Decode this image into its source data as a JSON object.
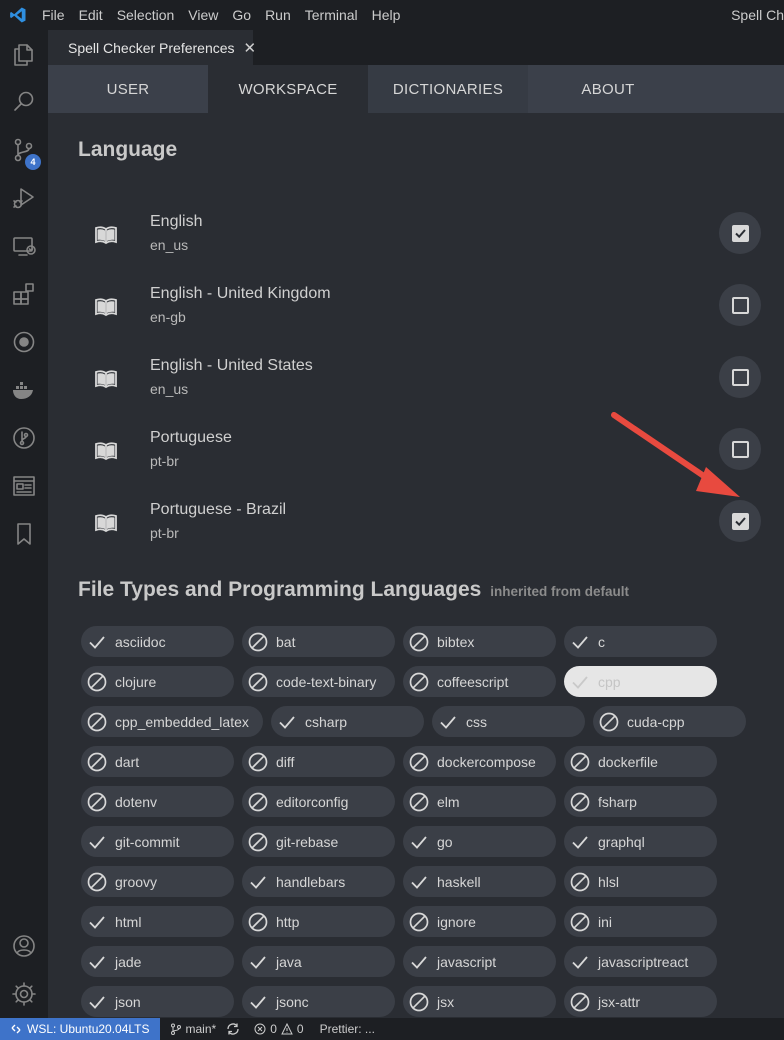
{
  "titlebar": {
    "menu": [
      "File",
      "Edit",
      "Selection",
      "View",
      "Go",
      "Run",
      "Terminal",
      "Help"
    ],
    "window_title": "Spell Ch"
  },
  "activity_bar": {
    "icons": [
      "explorer-icon",
      "search-icon",
      "source-control-icon",
      "run-debug-icon",
      "remote-explorer-icon",
      "extensions-icon",
      "gitlens-icon",
      "docker-icon",
      "git-graph-icon",
      "preview-icon",
      "bookmarks-icon",
      "account-icon",
      "settings-gear-icon"
    ],
    "source_control_badge": "4"
  },
  "editor_tab": {
    "label": "Spell Checker Preferences",
    "close": "✕"
  },
  "nav_tabs": [
    {
      "label": "USER"
    },
    {
      "label": "WORKSPACE"
    },
    {
      "label": "DICTIONARIES"
    },
    {
      "label": "ABOUT"
    }
  ],
  "language_section": {
    "title": "Language",
    "items": [
      {
        "name": "English",
        "code": "en_us",
        "checked": true
      },
      {
        "name": "English - United Kingdom",
        "code": "en-gb",
        "checked": false
      },
      {
        "name": "English - United States",
        "code": "en_us",
        "checked": false
      },
      {
        "name": "Portuguese",
        "code": "pt-br",
        "checked": false
      },
      {
        "name": "Portuguese - Brazil",
        "code": "pt-br",
        "checked": true
      }
    ]
  },
  "filetypes_section": {
    "title": "File Types and Programming Languages",
    "subtitle": "inherited from default",
    "rows": [
      [
        {
          "label": "asciidoc",
          "state": "enabled"
        },
        {
          "label": "bat",
          "state": "disabled"
        },
        {
          "label": "bibtex",
          "state": "disabled"
        },
        {
          "label": "c",
          "state": "enabled"
        }
      ],
      [
        {
          "label": "clojure",
          "state": "disabled"
        },
        {
          "label": "code-text-binary",
          "state": "disabled"
        },
        {
          "label": "coffeescript",
          "state": "disabled"
        },
        {
          "label": "cpp",
          "state": "hover"
        }
      ],
      [
        {
          "label": "cpp_embedded_latex",
          "state": "disabled"
        },
        {
          "label": "csharp",
          "state": "enabled"
        },
        {
          "label": "css",
          "state": "enabled"
        },
        {
          "label": "cuda-cpp",
          "state": "disabled"
        }
      ],
      [
        {
          "label": "dart",
          "state": "disabled"
        },
        {
          "label": "diff",
          "state": "disabled"
        },
        {
          "label": "dockercompose",
          "state": "disabled"
        },
        {
          "label": "dockerfile",
          "state": "disabled"
        }
      ],
      [
        {
          "label": "dotenv",
          "state": "disabled"
        },
        {
          "label": "editorconfig",
          "state": "disabled"
        },
        {
          "label": "elm",
          "state": "disabled"
        },
        {
          "label": "fsharp",
          "state": "disabled"
        }
      ],
      [
        {
          "label": "git-commit",
          "state": "enabled"
        },
        {
          "label": "git-rebase",
          "state": "disabled"
        },
        {
          "label": "go",
          "state": "enabled"
        },
        {
          "label": "graphql",
          "state": "enabled"
        }
      ],
      [
        {
          "label": "groovy",
          "state": "disabled"
        },
        {
          "label": "handlebars",
          "state": "enabled"
        },
        {
          "label": "haskell",
          "state": "enabled"
        },
        {
          "label": "hlsl",
          "state": "disabled"
        }
      ],
      [
        {
          "label": "html",
          "state": "enabled"
        },
        {
          "label": "http",
          "state": "disabled"
        },
        {
          "label": "ignore",
          "state": "disabled"
        },
        {
          "label": "ini",
          "state": "disabled"
        }
      ],
      [
        {
          "label": "jade",
          "state": "enabled"
        },
        {
          "label": "java",
          "state": "enabled"
        },
        {
          "label": "javascript",
          "state": "enabled"
        },
        {
          "label": "javascriptreact",
          "state": "enabled"
        }
      ],
      [
        {
          "label": "json",
          "state": "enabled"
        },
        {
          "label": "jsonc",
          "state": "enabled"
        },
        {
          "label": "jsx",
          "state": "disabled"
        },
        {
          "label": "jsx-attr",
          "state": "disabled"
        }
      ]
    ]
  },
  "annotation": {
    "arrow_color": "#e84a3f"
  },
  "statusbar": {
    "remote": "WSL: Ubuntu20.04LTS",
    "branch": "main*",
    "errors": "0",
    "warnings": "0",
    "prettier": "Prettier: ..."
  },
  "colors": {
    "accent": "#3e73c9"
  }
}
